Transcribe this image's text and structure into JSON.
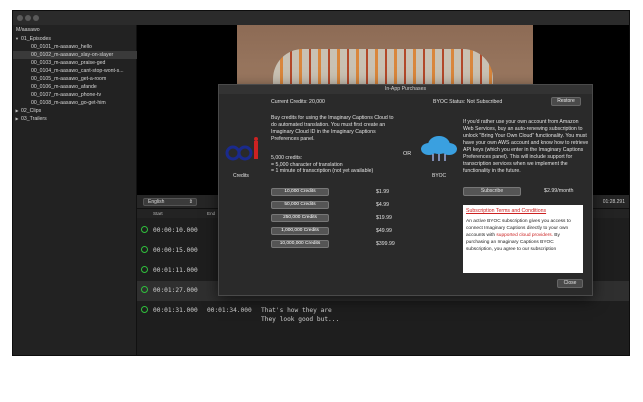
{
  "sidebar": {
    "project": "M/aasawo",
    "items": [
      {
        "label": "01_Episodes",
        "level": 0,
        "expanded": true
      },
      {
        "label": "00_0101_m-aasawo_hello",
        "level": 1
      },
      {
        "label": "00_0102_m-aasawo_slay-on-slayer",
        "level": 1,
        "selected": true
      },
      {
        "label": "00_0103_m-aasawo_praise-ged",
        "level": 1
      },
      {
        "label": "00_0104_m-aasawo_cant-stop-wont-s...",
        "level": 1
      },
      {
        "label": "00_0105_m-aasawo_get-a-room",
        "level": 1
      },
      {
        "label": "00_0106_m-aasawo_afande",
        "level": 1
      },
      {
        "label": "00_0107_m-aasawo_phone-tv",
        "level": 1
      },
      {
        "label": "00_0108_m-aasawo_go-get-him",
        "level": 1
      },
      {
        "label": "02_Clips",
        "level": 0,
        "expanded": false
      },
      {
        "label": "03_Trailers",
        "level": 0,
        "expanded": false
      }
    ]
  },
  "editor": {
    "language": "English",
    "timecode": "01:28.291",
    "col_start": "Start",
    "col_end": "End",
    "rows": [
      {
        "start": "00:00:10.000",
        "end": "",
        "text": "",
        "text2": ""
      },
      {
        "start": "00:00:15.000",
        "end": "",
        "text": "",
        "text2": ""
      },
      {
        "start": "00:01:11.000",
        "end": "",
        "text": "",
        "text2": ""
      },
      {
        "start": "00:01:27.000",
        "end": "",
        "text": "",
        "text2": "",
        "selected": true
      },
      {
        "start": "00:01:31.000",
        "end": "00:01:34.000",
        "text": "That's how they are",
        "text2": "They look good but..."
      }
    ]
  },
  "modal": {
    "title": "In-App Purchases",
    "current_credits": "Current Credits:  20,000",
    "byoc_status": "BYOC Status:   Not Subscribed",
    "restore_label": "Restore",
    "left_desc": "Buy credits for using the Imaginary Captions Cloud to do automated translation. You must first create an Imaginary Cloud ID in the Imaginary Captions Preferences panel.",
    "credits_label": "Credits",
    "or_label": "OR",
    "byoc_label": "BYOC",
    "credit_details": [
      "5,000 credits:",
      "= 5,000 character of translation",
      "= 1 minute of transcription (not yet available)"
    ],
    "packages": [
      {
        "label": "10,000 Credits",
        "price": "$1.99"
      },
      {
        "label": "50,000 Credits",
        "price": "$4.99"
      },
      {
        "label": "250,000 Credits",
        "price": "$19.99"
      },
      {
        "label": "1,000,000 Credits",
        "price": "$49.99"
      },
      {
        "label": "10,000,000 Credits",
        "price": "$399.99"
      }
    ],
    "right_desc": "If you'd rather use your own account from Amazon Web Services, buy an auto-renewing subscription to unlock \"Bring Your Own Cloud\" functionality. You must have your own AWS account and know how to retrieve API keys (which you enter in the Imaginary Captions Preferences panel). This will include support for transcription services when we implement the functionality in the future.",
    "subscribe_label": "Subscribe",
    "subscribe_price": "$2.99/month",
    "terms_title": "Subscription Terms and Conditions",
    "terms_p1": "An active BYOC subscription gives you access to connect Imaginary Captions directly to your own accounts with",
    "terms_link": "supported cloud providers.",
    "terms_p2": "By purchasing an Imaginary Captions BYOC subscription, you agree to our subscription",
    "close_label": "Close"
  },
  "colors": {
    "accent_red": "#cc2222",
    "logo_blue": "#1a2a8c",
    "cloud_blue": "#3aa0e0",
    "caption_icon_green": "#2fbf3c"
  },
  "icons": {
    "caption_row": "speech-bubble-icon",
    "cloud": "cloud-icon",
    "logo": "imaginary-captions-logo-icon"
  }
}
